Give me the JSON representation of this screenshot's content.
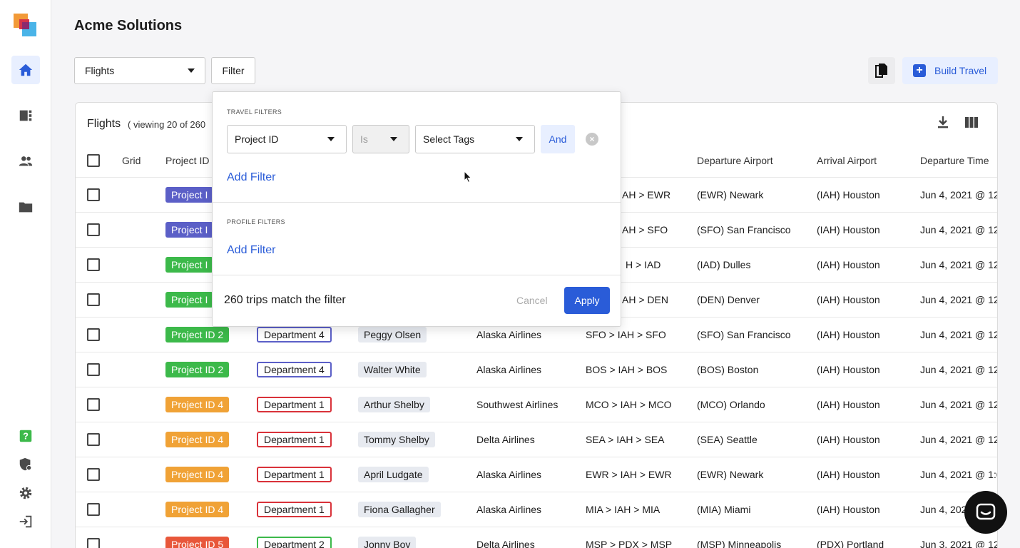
{
  "app": {
    "title": "Acme Solutions"
  },
  "toolbar": {
    "view_select": "Flights",
    "filter_label": "Filter",
    "build_label": "Build Travel",
    "build_icon": "plus-icon",
    "copy_icon": "copy-icon"
  },
  "sidebar": {
    "icons": [
      "home-icon",
      "dashboard-icon",
      "people-icon",
      "folder-icon",
      "help-icon",
      "shield-icon",
      "gear-icon",
      "logout-icon"
    ],
    "accent": "#2a5cd8"
  },
  "card": {
    "title": "Flights",
    "subtitle": "( viewing 20 of 260"
  },
  "table": {
    "headers": {
      "grid": "Grid",
      "project": "Project ID",
      "departure_airport": "Departure Airport",
      "arrival_airport": "Arrival Airport",
      "departure_time": "Departure Time"
    },
    "rows": [
      {
        "project": "Project I",
        "project_color": "#5b5fc7",
        "route": "AH > EWR",
        "dep": "(EWR) Newark",
        "arr": "(IAH) Houston",
        "time": "Jun 4, 2021 @ 12:"
      },
      {
        "project": "Project I",
        "project_color": "#5b5fc7",
        "route": "AH > SFO",
        "dep": "(SFO) San Francisco",
        "arr": "(IAH) Houston",
        "time": "Jun 4, 2021 @ 12:"
      },
      {
        "project": "Project I",
        "project_color": "#3cb94a",
        "route": "H > IAD",
        "dep": "(IAD) Dulles",
        "arr": "(IAH) Houston",
        "time": "Jun 4, 2021 @ 12:"
      },
      {
        "project": "Project I",
        "project_color": "#3cb94a",
        "route": "AH > DEN",
        "dep": "(DEN) Denver",
        "arr": "(IAH) Houston",
        "time": "Jun 4, 2021 @ 12:"
      },
      {
        "project": "Project ID 2",
        "project_color": "#3cb94a",
        "dept": "Department 4",
        "dept_color": "#5b5fc7",
        "person": "Peggy Olsen",
        "airline": "Alaska Airlines",
        "route": "SFO > IAH > SFO",
        "dep": "(SFO) San Francisco",
        "arr": "(IAH) Houston",
        "time": "Jun 4, 2021 @ 12:"
      },
      {
        "project": "Project ID 2",
        "project_color": "#3cb94a",
        "dept": "Department 4",
        "dept_color": "#5b5fc7",
        "person": "Walter White",
        "airline": "Alaska Airlines",
        "route": "BOS > IAH > BOS",
        "dep": "(BOS) Boston",
        "arr": "(IAH) Houston",
        "time": "Jun 4, 2021 @ 12:"
      },
      {
        "project": "Project ID 4",
        "project_color": "#f0a236",
        "dept": "Department 1",
        "dept_color": "#d9323a",
        "person": "Arthur Shelby",
        "airline": "Southwest Airlines",
        "route": "MCO > IAH > MCO",
        "dep": "(MCO) Orlando",
        "arr": "(IAH) Houston",
        "time": "Jun 4, 2021 @ 12:"
      },
      {
        "project": "Project ID 4",
        "project_color": "#f0a236",
        "dept": "Department 1",
        "dept_color": "#d9323a",
        "person": "Tommy Shelby",
        "airline": "Delta Airlines",
        "route": "SEA > IAH > SEA",
        "dep": "(SEA) Seattle",
        "arr": "(IAH) Houston",
        "time": "Jun 4, 2021 @ 12:"
      },
      {
        "project": "Project ID 4",
        "project_color": "#f0a236",
        "dept": "Department 1",
        "dept_color": "#d9323a",
        "person": "April Ludgate",
        "airline": "Alaska Airlines",
        "route": "EWR > IAH > EWR",
        "dep": "(EWR) Newark",
        "arr": "(IAH) Houston",
        "time": "Jun 4, 2021 @ 1:0"
      },
      {
        "project": "Project ID 4",
        "project_color": "#f0a236",
        "dept": "Department 1",
        "dept_color": "#d9323a",
        "person": "Fiona Gallagher",
        "airline": "Alaska Airlines",
        "route": "MIA > IAH > MIA",
        "dep": "(MIA) Miami",
        "arr": "(IAH) Houston",
        "time": "Jun 4, 2021"
      },
      {
        "project": "Project ID 5",
        "project_color": "#e8573a",
        "dept": "Department 2",
        "dept_color": "#3cb94a",
        "person": "Jonny Boy",
        "airline": "Delta Airlines",
        "route": "MSP > PDX > MSP",
        "dep": "(MSP) Minneapolis",
        "arr": "(PDX) Portland",
        "time": "Jun 3, 2021 @ 12:"
      }
    ]
  },
  "filter": {
    "travel_label": "TRAVEL FILTERS",
    "field": "Project ID",
    "operator": "Is",
    "value_placeholder": "Select Tags",
    "and_label": "And",
    "add_filter": "Add Filter",
    "profile_label": "PROFILE FILTERS",
    "profile_add_filter": "Add Filter",
    "match_text": "260 trips match the filter",
    "cancel": "Cancel",
    "apply": "Apply"
  }
}
